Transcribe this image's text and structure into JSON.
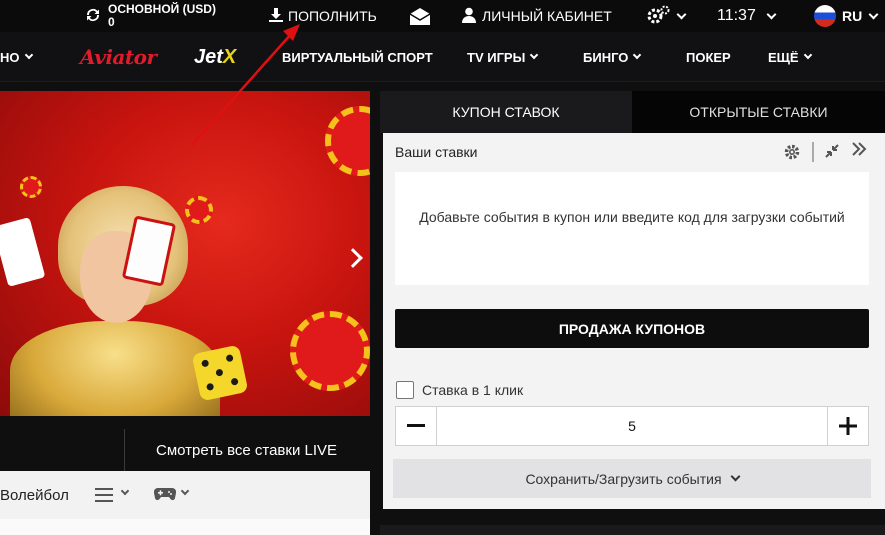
{
  "topbar": {
    "balance_label": "ОСНОВНОЙ (USD)",
    "balance_value": "0",
    "deposit": "ПОПОЛНИТЬ",
    "cabinet": "ЛИЧНЫЙ КАБИНЕТ",
    "time": "11:37",
    "lang": "RU"
  },
  "nav": {
    "items": [
      {
        "label": "НО"
      },
      {
        "label": "Aviator"
      },
      {
        "label": "Jet"
      },
      {
        "label": "X"
      },
      {
        "label": "ВИРТУАЛЬНЫЙ СПОРТ"
      },
      {
        "label": "TV ИГРЫ"
      },
      {
        "label": "БИНГО"
      },
      {
        "label": "ПОКЕР"
      },
      {
        "label": "ЕЩЁ"
      }
    ]
  },
  "live": {
    "label": "Смотреть все ставки LIVE"
  },
  "sports": {
    "label": "Волейбол"
  },
  "coupon": {
    "tabs": [
      "КУПОН СТАВОК",
      "ОТКРЫТЫЕ СТАВКИ"
    ],
    "header": "Ваши ставки",
    "empty_text": "Добавьте события в купон или введите код для загрузки событий",
    "sell_button": "ПРОДАЖА КУПОНОВ",
    "one_click_label": "Ставка в 1 клик",
    "stake_value": "5",
    "save_load": "Сохранить/Загрузить события"
  },
  "colors": {
    "accent_red": "#e21b2b",
    "jetx_yellow": "#e8d21a",
    "annotation_arrow": "#e01010"
  },
  "icons": [
    "refresh-icon",
    "download-icon",
    "mail-icon",
    "user-icon",
    "settings-icon",
    "flag-ru-icon",
    "gear-icon",
    "compress-icon",
    "collapse-icon",
    "list-icon",
    "gamepad-icon",
    "chevron-right-icon"
  ]
}
